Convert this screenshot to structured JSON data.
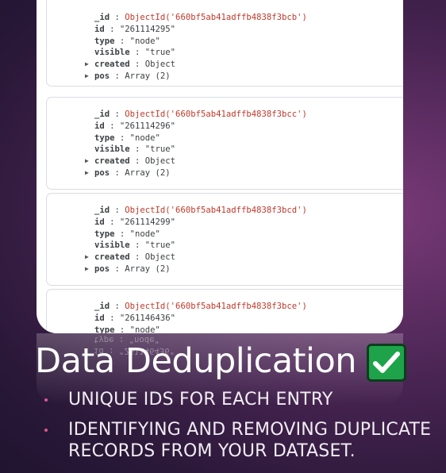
{
  "documents": [
    {
      "_id_value": "ObjectId('660bf5ab41adffb4838f3bcb')",
      "id": "\"261114295\"",
      "type": "\"node\"",
      "visible": "\"true\"",
      "created": "Object",
      "pos": "Array (2)"
    },
    {
      "_id_value": "ObjectId('660bf5ab41adffb4838f3bcc')",
      "id": "\"261114296\"",
      "type": "\"node\"",
      "visible": "\"true\"",
      "created": "Object",
      "pos": "Array (2)"
    },
    {
      "_id_value": "ObjectId('660bf5ab41adffb4838f3bcd')",
      "id": "\"261114299\"",
      "type": "\"node\"",
      "visible": "\"true\"",
      "created": "Object",
      "pos": "Array (2)"
    },
    {
      "_id_value": "ObjectId('660bf5ab41adffb4838f3bce')",
      "id": "\"261146436\"",
      "type": "\"node\""
    }
  ],
  "keys": {
    "_id": "_id",
    "id": "id",
    "type": "type",
    "visible": "visible",
    "created": "created",
    "pos": "pos"
  },
  "title": "Data Deduplication",
  "check_icon": "white-check-mark-icon",
  "bullets": [
    {
      "line1": "UNIQUE IDS FOR EACH ENTRY"
    },
    {
      "line1": "IDENTIFYING AND REMOVING DUPLICATE",
      "line2": "RECORDS FROM YOUR DATASET."
    }
  ],
  "colors": {
    "accent_bullet": "#e0568f",
    "check_bg": "#1ea34a",
    "oid": "#c0392b"
  }
}
